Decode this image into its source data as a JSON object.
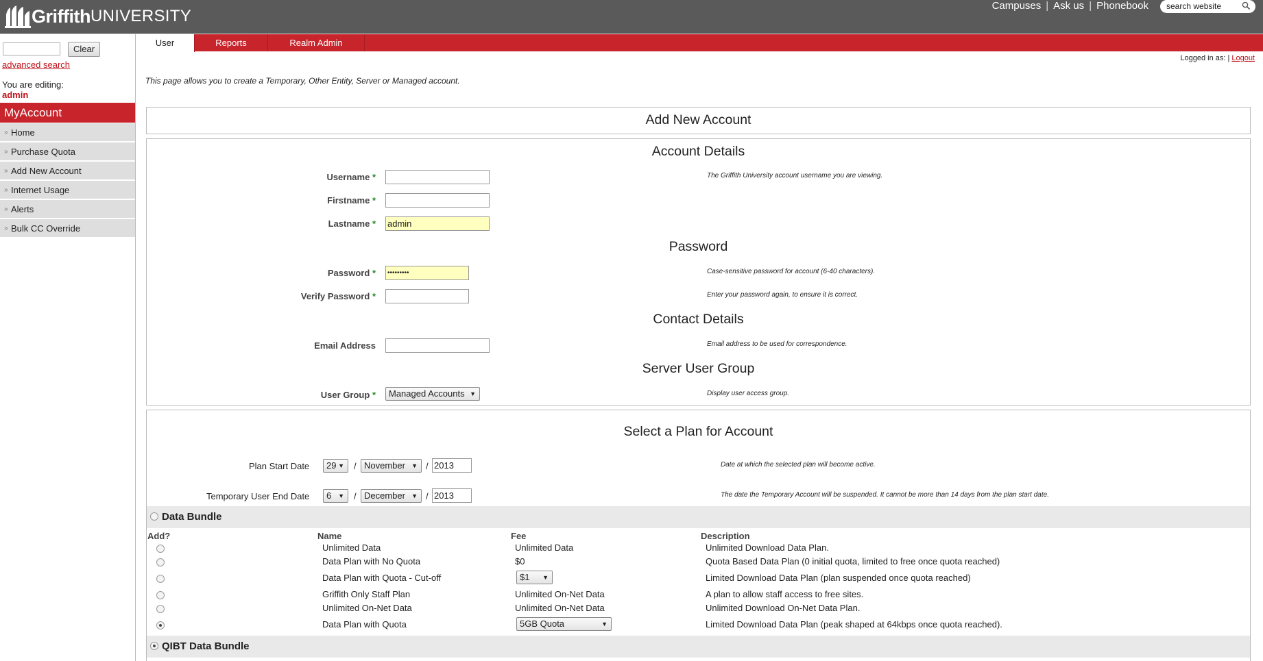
{
  "header": {
    "brand_strong": "Griffith",
    "brand_light": "UNIVERSITY",
    "links": [
      "Campuses",
      "Ask us",
      "Phonebook"
    ],
    "search_placeholder": "search website"
  },
  "sidebar": {
    "clear_label": "Clear",
    "advanced_search": "advanced search",
    "editing_label": "You are editing:",
    "editing_user": "admin",
    "section_title": "MyAccount",
    "items": [
      "Home",
      "Purchase Quota",
      "Add New Account",
      "Internet Usage",
      "Alerts",
      "Bulk CC Override"
    ]
  },
  "tabs": [
    "User",
    "Reports",
    "Realm Admin"
  ],
  "session": {
    "logged_in_as": "Logged in as:",
    "logout": "Logout"
  },
  "intro": "This page allows you to create a Temporary, Other Entity, Server or Managed account.",
  "page_title": "Add New Account",
  "account_details": {
    "heading": "Account Details",
    "username_label": "Username",
    "firstname_label": "Firstname",
    "lastname_label": "Lastname",
    "lastname_value": "admin",
    "username_help": "The Griffith University account username you are viewing."
  },
  "password": {
    "heading": "Password",
    "password_label": "Password",
    "password_value": "•••••••••",
    "verify_label": "Verify Password",
    "password_help": "Case-sensitive password for account (6-40 characters).",
    "verify_help": "Enter your password again, to ensure it is correct."
  },
  "contact": {
    "heading": "Contact Details",
    "email_label": "Email Address",
    "email_help": "Email address to be used for correspondence."
  },
  "server_group": {
    "heading": "Server User Group",
    "group_label": "User Group",
    "group_value": "Managed Accounts",
    "group_help": "Display user access group."
  },
  "plan": {
    "heading": "Select a Plan for Account",
    "start_label": "Plan Start Date",
    "start_day": "29",
    "start_month": "November",
    "start_year": "2013",
    "start_help": "Date at which the selected plan will become active.",
    "end_label": "Temporary User End Date",
    "end_day": "6",
    "end_month": "December",
    "end_year": "2013",
    "end_help": "The date the Temporary Account will be suspended. It cannot be more than 14 days from the plan start date.",
    "required_mark": "*",
    "date_sep": "/"
  },
  "data_bundle": {
    "title": "Data Bundle",
    "columns": [
      "Add?",
      "Name",
      "Fee",
      "Description"
    ],
    "rows": [
      {
        "name": "Unlimited Data",
        "fee": "Unlimited Data",
        "description": "Unlimited Download Data Plan.",
        "selected": false
      },
      {
        "name": "Data Plan with No Quota",
        "fee": "$0",
        "description": "Quota Based Data Plan (0 initial quota, limited to free once quota reached)",
        "selected": false
      },
      {
        "name": "Data Plan with Quota - Cut-off",
        "fee": "$1",
        "description": "Limited Download Data Plan (plan suspended once quota reached)",
        "selected": false
      },
      {
        "name": "Griffith Only Staff Plan",
        "fee": "Unlimited On-Net Data",
        "description": "A plan to allow staff access to free sites.",
        "selected": false
      },
      {
        "name": "Unlimited On-Net Data",
        "fee": "Unlimited On-Net Data",
        "description": "Unlimited Download On-Net Data Plan.",
        "selected": false
      },
      {
        "name": "Data Plan with Quota",
        "fee": "5GB Quota",
        "description": "Limited Download Data Plan (peak shaped at 64kbps once quota reached).",
        "selected": true
      }
    ]
  },
  "qibt_bundle": {
    "title": "QIBT Data Bundle"
  },
  "colors": {
    "brand_red": "#c8242b",
    "header_gray": "#5a5a5a",
    "link_red": "#c0121a"
  }
}
